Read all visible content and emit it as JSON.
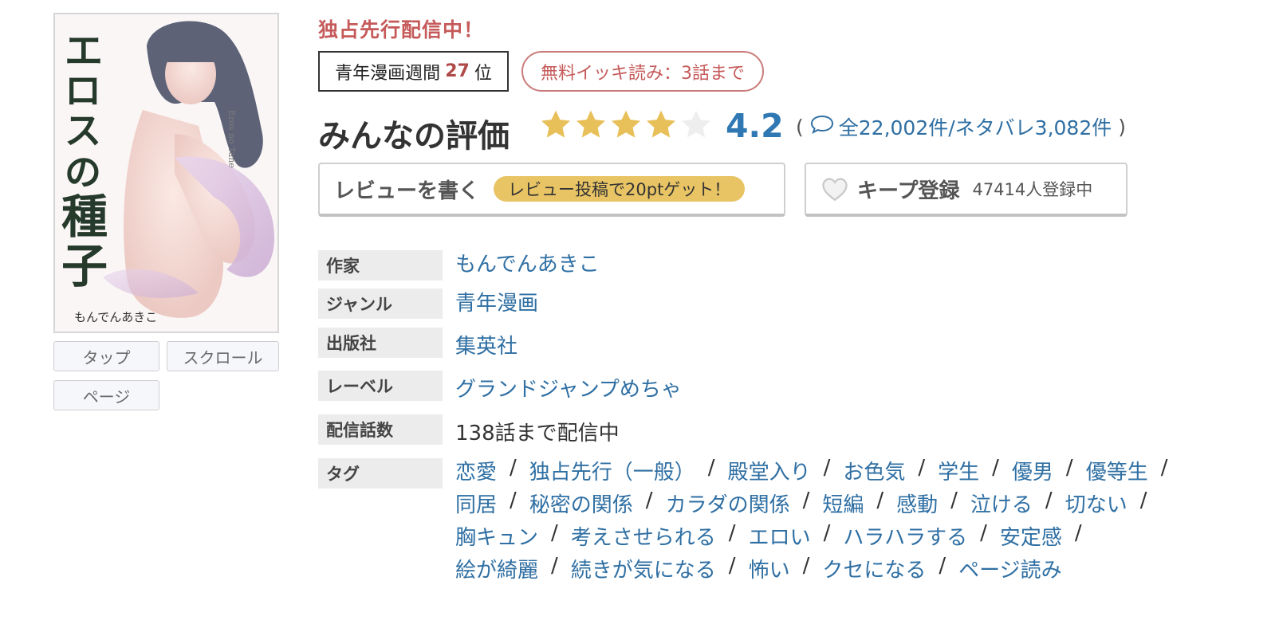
{
  "cover": {
    "title_chars": [
      "エ",
      "ロ",
      "ス",
      "の",
      "種",
      "子"
    ],
    "author": "もんでんあきこ",
    "subtitle": "Eros no Tane"
  },
  "view_buttons": [
    "タップ",
    "スクロール",
    "ページ"
  ],
  "exclusive_label": "独占先行配信中！",
  "ranking": {
    "prefix": "青年漫画週間",
    "rank": "27",
    "suffix": "位"
  },
  "free_badge": "無料イッキ読み：3話まで",
  "rating": {
    "title": "みんなの評価",
    "score": "4.2",
    "stars_value": 4.2,
    "open_paren": "(",
    "counts": "全22,002件/ネタバレ3,082件",
    "close_paren": ")"
  },
  "review_button": {
    "label": "レビューを書く",
    "bonus": "レビュー投稿で20ptゲット！"
  },
  "keep_button": {
    "label": "キープ登録",
    "count": "47414人登録中"
  },
  "info": {
    "author": {
      "label": "作家",
      "value": "もんでんあきこ"
    },
    "genre": {
      "label": "ジャンル",
      "value": "青年漫画"
    },
    "publisher": {
      "label": "出版社",
      "value": "集英社"
    },
    "label": {
      "label": "レーベル",
      "value": "グランドジャンプめちゃ"
    },
    "episodes": {
      "label": "配信話数",
      "value": "138話まで配信中"
    },
    "tags": {
      "label": "タグ",
      "lines": [
        [
          "恋愛",
          "独占先行（一般）",
          "殿堂入り",
          "お色気",
          "学生",
          "優男",
          "優等生"
        ],
        [
          "同居",
          "秘密の関係",
          "カラダの関係",
          "短編",
          "感動",
          "泣ける",
          "切ない"
        ],
        [
          "胸キュン",
          "考えさせられる",
          "エロい",
          "ハラハラする",
          "安定感"
        ],
        [
          "絵が綺麗",
          "続きが気になる",
          "怖い",
          "クセになる",
          "ページ読み"
        ]
      ]
    }
  },
  "colors": {
    "accent_red": "#c65a5a",
    "link_blue": "#2f6fa3",
    "score_blue": "#2f78b3",
    "star_gold": "#e8c05a",
    "bonus_yellow": "#e8c465"
  }
}
